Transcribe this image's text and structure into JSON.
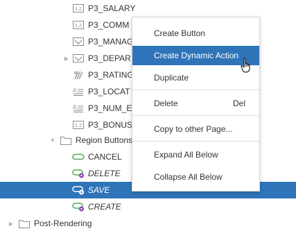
{
  "tree": {
    "items": [
      {
        "label": "P3_SALARY",
        "icon": "number-field-icon",
        "italic": false
      },
      {
        "label": "P3_COMM",
        "icon": "number-field-icon",
        "italic": false
      },
      {
        "label": "P3_MANAG",
        "icon": "select-list-icon",
        "italic": false
      },
      {
        "label": "P3_DEPAR",
        "icon": "select-list-icon",
        "italic": false
      },
      {
        "label": "P3_RATING",
        "icon": "star-rating-icon",
        "italic": false
      },
      {
        "label": "P3_LOCAT",
        "icon": "text-field-icon",
        "italic": false
      },
      {
        "label": "P3_NUM_E",
        "icon": "text-field-icon",
        "italic": false
      },
      {
        "label": "P3_BONUS",
        "icon": "number-field-icon",
        "italic": false
      },
      {
        "label": "Region Buttons",
        "icon": "folder-icon",
        "italic": false
      },
      {
        "label": "CANCEL",
        "icon": "button-icon",
        "italic": false
      },
      {
        "label": "DELETE",
        "icon": "button-action-icon",
        "italic": true
      },
      {
        "label": "SAVE",
        "icon": "button-action-icon",
        "italic": true
      },
      {
        "label": "CREATE",
        "icon": "button-action-icon",
        "italic": true
      },
      {
        "label": "Post-Rendering",
        "icon": "folder-icon",
        "italic": false
      }
    ],
    "selected": "SAVE"
  },
  "context_menu": {
    "items": [
      {
        "label": "Create Button",
        "shortcut": ""
      },
      {
        "label": "Create Dynamic Action",
        "shortcut": ""
      },
      {
        "label": "Duplicate",
        "shortcut": ""
      },
      {
        "label": "Delete",
        "shortcut": "Del"
      },
      {
        "label": "Copy to other Page...",
        "shortcut": ""
      },
      {
        "label": "Expand All Below",
        "shortcut": ""
      },
      {
        "label": "Collapse All Below",
        "shortcut": ""
      }
    ],
    "highlighted": "Create Dynamic Action"
  },
  "colors": {
    "selection": "#2f74b9",
    "text": "#333333",
    "icon": "#7a7a7a",
    "button_icon": "#4caf50",
    "action_badge": "#8e44ad"
  },
  "icons": {
    "number-field": "1.2",
    "pointer": "hand-pointer-icon"
  }
}
